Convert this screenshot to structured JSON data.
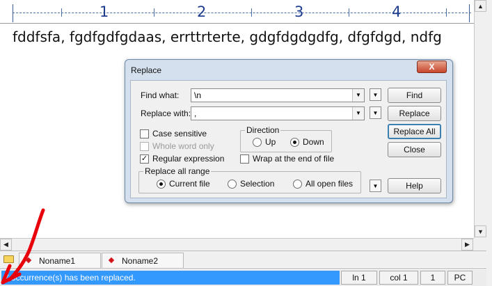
{
  "ruler": {
    "numbers": [
      "1",
      "2",
      "3",
      "4"
    ]
  },
  "editor": {
    "text": "fddfsfa, fgdfgdfgdaas, errttrterte, gdgfdgdgdfg, dfgfdgd, ndfg"
  },
  "tabs": [
    {
      "label": "Noname1"
    },
    {
      "label": "Noname2"
    }
  ],
  "status": {
    "message": "7 occurrence(s) has been replaced.",
    "line": "ln 1",
    "col": "col 1",
    "field3": "1",
    "mode": "PC"
  },
  "dialog": {
    "title": "Replace",
    "close_label": "X",
    "find_label": "Find what:",
    "find_value": "\\n",
    "replace_label": "Replace with:",
    "replace_value": ",",
    "buttons": {
      "find": "Find",
      "replace": "Replace",
      "replace_all": "Replace All",
      "close": "Close",
      "help": "Help"
    },
    "options": {
      "case_sensitive": "Case sensitive",
      "whole_word": "Whole word only",
      "regex": "Regular expression",
      "wrap": "Wrap at the end of file"
    },
    "direction": {
      "title": "Direction",
      "up": "Up",
      "down": "Down"
    },
    "range": {
      "title": "Replace all range",
      "current": "Current file",
      "selection": "Selection",
      "all_open": "All open files"
    }
  },
  "colors": {
    "status_highlight": "#3399ff",
    "annotation": "#e8000b",
    "ruler_text": "#1f3d8f"
  },
  "icons": [
    "folder-icon",
    "scroll-up-icon",
    "scroll-down-icon",
    "scroll-left-icon",
    "scroll-right-icon",
    "dropdown-arrow-icon",
    "close-icon",
    "red-arrow-annotation"
  ]
}
